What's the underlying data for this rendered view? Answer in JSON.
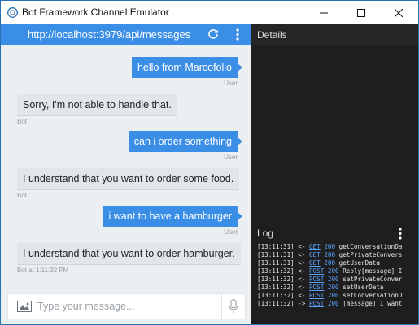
{
  "window": {
    "title": "Bot Framework Channel Emulator",
    "controls": {
      "minimize": "—",
      "maximize": "☐",
      "close": "✕"
    }
  },
  "chat": {
    "endpoint_url": "http://localhost:3979/api/messages",
    "messages": [
      {
        "from": "user",
        "text": "hello from Marcofolio",
        "meta": "User"
      },
      {
        "from": "bot",
        "text": "Sorry, I'm not able to handle that.",
        "meta": "Bot"
      },
      {
        "from": "user",
        "text": "can i order something",
        "meta": "User"
      },
      {
        "from": "bot",
        "text": "I understand that you want to order some food.",
        "meta": "Bot"
      },
      {
        "from": "user",
        "text": "i want to have a hamburger",
        "meta": "User"
      },
      {
        "from": "bot",
        "text": "I understand that you want to order hamburger.",
        "meta": "Bot at 1:11:32 PM"
      }
    ],
    "composer": {
      "placeholder": "Type your message..."
    }
  },
  "details": {
    "title": "Details"
  },
  "log": {
    "title": "Log",
    "entries": [
      {
        "time": "[13:11:31]",
        "dir": "<-",
        "method": "GET",
        "status": "200",
        "text": "getConversationDa"
      },
      {
        "time": "[13:11:31]",
        "dir": "<-",
        "method": "GET",
        "status": "200",
        "text": "getPrivateConvers"
      },
      {
        "time": "[13:11:31]",
        "dir": "<-",
        "method": "GET",
        "status": "200",
        "text": "getUserData"
      },
      {
        "time": "[13:11:32]",
        "dir": "<-",
        "method": "POST",
        "status": "200",
        "text": "Reply[message] I"
      },
      {
        "time": "[13:11:32]",
        "dir": "<-",
        "method": "POST",
        "status": "200",
        "text": "setPrivateConver"
      },
      {
        "time": "[13:11:32]",
        "dir": "<-",
        "method": "POST",
        "status": "200",
        "text": "setUserData"
      },
      {
        "time": "[13:11:32]",
        "dir": "<-",
        "method": "POST",
        "status": "200",
        "text": "setConversationD"
      },
      {
        "time": "[13:11:32]",
        "dir": "->",
        "method": "POST",
        "status": "200",
        "text": "[message] I want"
      }
    ]
  },
  "colors": {
    "accent": "#3a8ee6",
    "panel_dark": "#1e1e1e",
    "chat_bg": "#eceff1",
    "link": "#5aa3ff"
  },
  "icons": [
    "app-icon",
    "minimize-icon",
    "maximize-icon",
    "close-icon",
    "refresh-icon",
    "more-vertical-icon",
    "image-icon",
    "microphone-icon"
  ]
}
